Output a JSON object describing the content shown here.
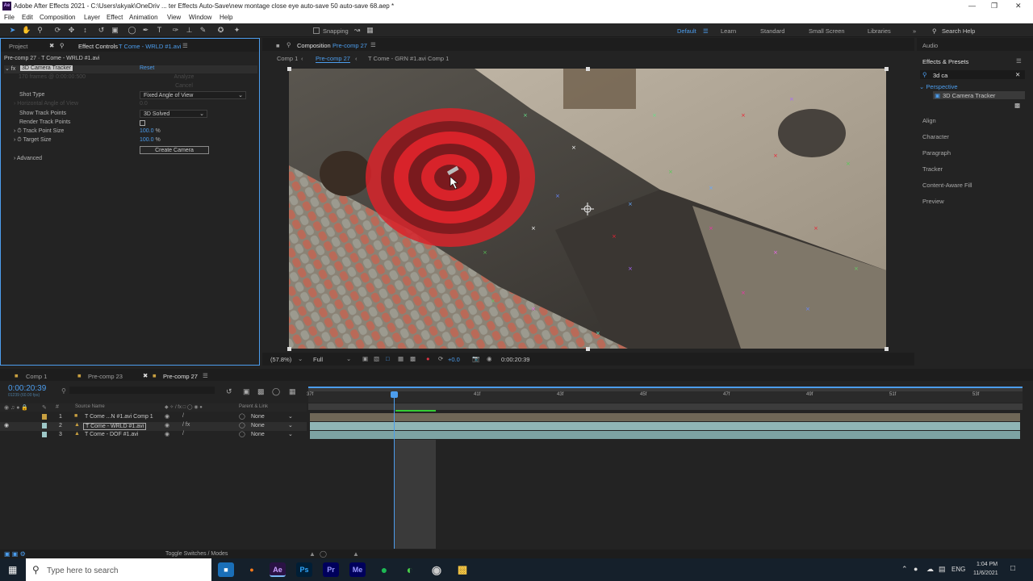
{
  "window": {
    "title": "Adobe After Effects 2021 - C:\\Users\\skyak\\OneDriv ... ter Effects Auto-Save\\new montage close eye auto-save 50 auto-save 68.aep *",
    "app_icon": "Ae"
  },
  "menu": [
    "File",
    "Edit",
    "Composition",
    "Layer",
    "Effect",
    "Animation",
    "View",
    "Window",
    "Help"
  ],
  "toolbar": {
    "snapping": "Snapping",
    "workspaces": [
      "Default",
      "Learn",
      "Standard",
      "Small Screen",
      "Libraries"
    ],
    "active_workspace": "Default",
    "search_placeholder": "Search Help"
  },
  "left_panel": {
    "tab_project": "Project",
    "tab_effect_controls": "Effect Controls",
    "tab_effect_controls_layer": "T Come - WRLD #1.avi",
    "breadcrumb": "Pre-comp 27 · T Come - WRLD #1.avi",
    "effect_name": "3D Camera Tracker",
    "reset": "Reset",
    "frames_info": "170 frames @ 0:00:00:500",
    "analyze": "Analyze",
    "cancel": "Cancel",
    "shot_type_label": "Shot Type",
    "shot_type_value": "Fixed Angle of View",
    "horiz_aov_label": "Horizontal Angle of View",
    "horiz_aov_value": "0.0",
    "show_track_points_label": "Show Track Points",
    "show_track_points_value": "3D Solved",
    "render_track_points_label": "Render Track Points",
    "track_point_size_label": "Track Point Size",
    "track_point_size_value": "100.0",
    "target_size_label": "Target Size",
    "target_size_value": "100.0",
    "percent": "%",
    "create_camera": "Create Camera",
    "advanced": "Advanced"
  },
  "composition": {
    "panel_label": "Composition",
    "panel_name": "Pre-comp 27",
    "tabs": [
      "Comp 1",
      "Pre-comp 27",
      "T Come - GRN #1.avi Comp 1"
    ],
    "active_tab": "Pre-comp 27",
    "zoom": "(57.8%)",
    "resolution": "Full",
    "exposure": "+0.0",
    "timecode": "0:00:20:39"
  },
  "right_panel": {
    "audio": "Audio",
    "effects_presets": "Effects & Presets",
    "search_value": "3d ca",
    "category": "Perspective",
    "result": "3D Camera Tracker",
    "sections": [
      "Align",
      "Character",
      "Paragraph",
      "Tracker",
      "Content-Aware Fill",
      "Preview"
    ]
  },
  "timeline": {
    "tabs": [
      "Comp 1",
      "Pre-comp 23",
      "Pre-comp 27"
    ],
    "active_tab": "Pre-comp 27",
    "timecode": "0:00:20:39",
    "frame_info": "01239 (60.00 fps)",
    "col_source": "Source Name",
    "col_parent": "Parent & Link",
    "ruler": [
      "37f",
      "39f",
      "41f",
      "43f",
      "45f",
      "47f",
      "49f",
      "51f",
      "53f"
    ],
    "layers": [
      {
        "num": "1",
        "name": "T Come ...N #1.avi Comp 1",
        "parent": "None"
      },
      {
        "num": "2",
        "name": "T Come - WRLD #1.avi",
        "parent": "None"
      },
      {
        "num": "3",
        "name": "T Come - DOF #1.avi",
        "parent": "None"
      }
    ],
    "toggle": "Toggle Switches / Modes"
  },
  "taskbar": {
    "search_placeholder": "Type here to search",
    "apps": [
      "Ae",
      "Ps",
      "Pr",
      "Me"
    ],
    "active_app": "Ae",
    "lang": "ENG",
    "time": "1:04 PM",
    "date": "11/6/2021"
  },
  "colors": {
    "accent": "#4c9ded",
    "target_red": "#d8232a",
    "panel": "#232323"
  }
}
